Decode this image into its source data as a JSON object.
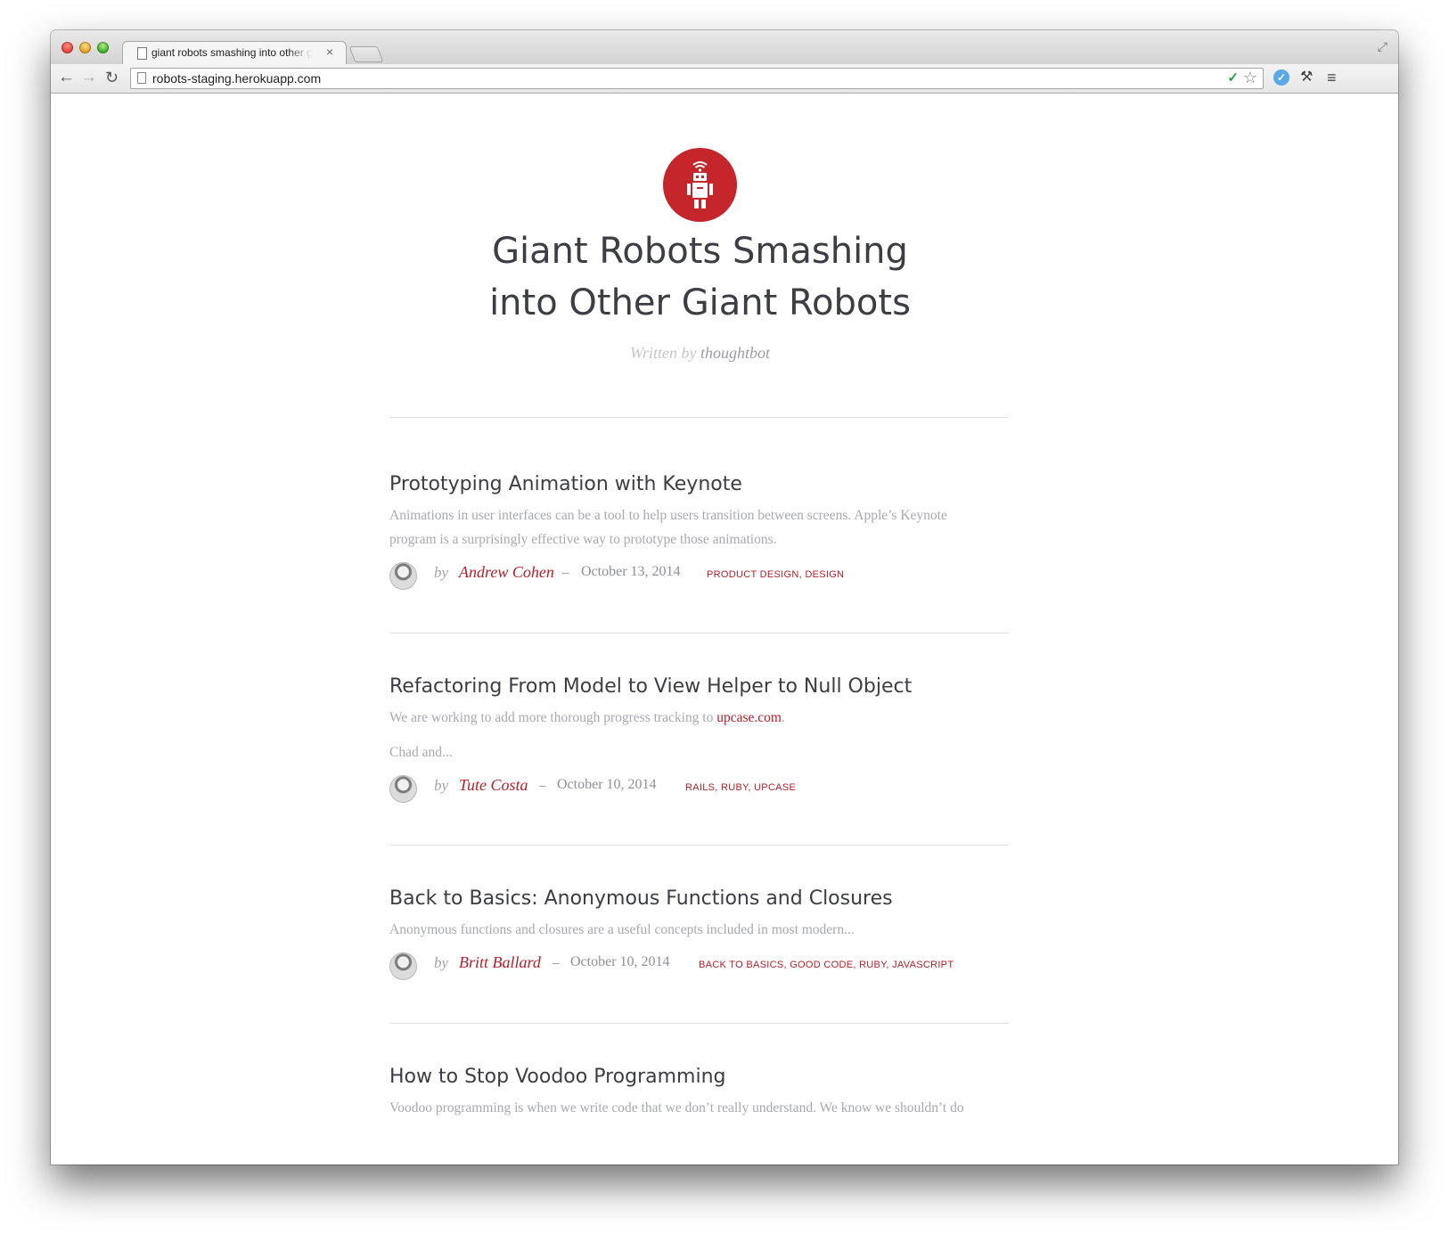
{
  "browser": {
    "tab_title": "giant robots smashing into other giant robots",
    "tab_close": "×",
    "url": "robots-staging.herokuapp.com",
    "back": "←",
    "forward": "→",
    "reload": "↻",
    "star": "☆",
    "ext_check": "✓",
    "ext_blue": "✓",
    "ext_tool": "⚒",
    "menu": "≡",
    "fullscreen": "⤢"
  },
  "blog": {
    "title_line1": "Giant Robots Smashing",
    "title_line2": "into Other Giant Robots",
    "written_by": "Written by",
    "author": "thoughtbot",
    "logo_color": "#c5262c"
  },
  "posts": [
    {
      "title": "Prototyping Animation with Keynote",
      "excerpt": "Animations in user interfaces can be a tool to help users transition between screens. Apple’s Keynote program is a surprisingly effective way to prototype those animations.",
      "by": "by",
      "author": "Andrew Cohen",
      "dash": "–",
      "date": "October 13, 2014",
      "tags": "PRODUCT DESIGN, DESIGN"
    },
    {
      "title": "Refactoring From Model to View Helper to Null Object",
      "excerpt_before": "We are working to add more thorough progress tracking to ",
      "excerpt_link": "upcase.com",
      "excerpt_after": ".",
      "excerpt2": "Chad and...",
      "by": "by",
      "author": "Tute Costa",
      "dash": "–",
      "date": "October 10, 2014",
      "tags": "RAILS, RUBY, UPCASE"
    },
    {
      "title": "Back to Basics: Anonymous Functions and Closures",
      "excerpt": "Anonymous functions and closures are a useful concepts included in most modern...",
      "by": "by",
      "author": "Britt Ballard",
      "dash": "–",
      "date": "October 10, 2014",
      "tags": "BACK TO BASICS, GOOD CODE, RUBY, JAVASCRIPT"
    },
    {
      "title": "How to Stop Voodoo Programming",
      "excerpt": "Voodoo programming is when we write code that we don’t really understand. We know we shouldn’t do"
    }
  ],
  "colors": {
    "accent": "#b61f28",
    "heading": "#3c3d45",
    "muted": "#a8a8b4"
  }
}
